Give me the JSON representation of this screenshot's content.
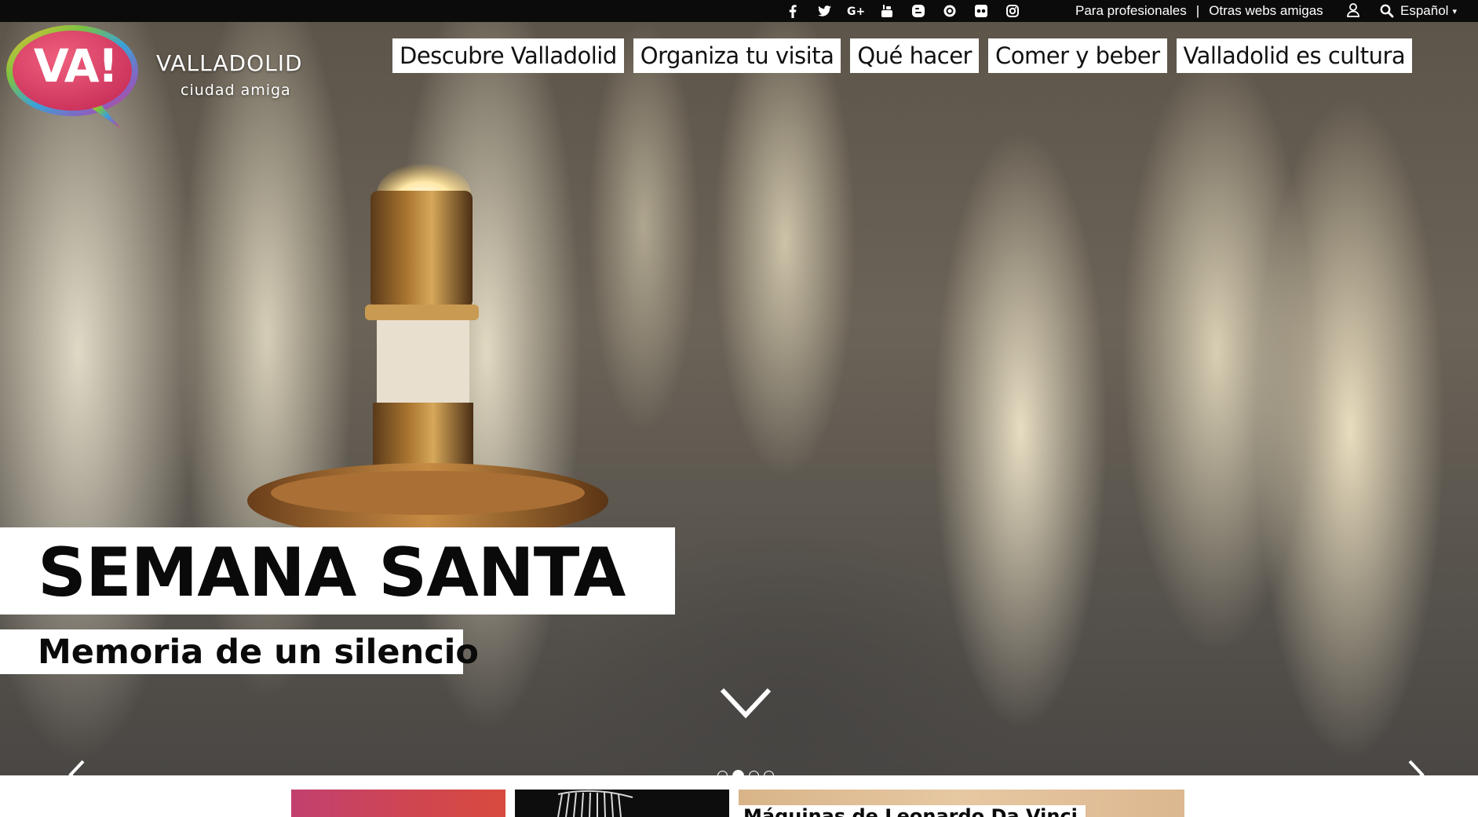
{
  "topbar": {
    "social_icons": [
      "facebook-icon",
      "twitter-icon",
      "google-plus-icon",
      "youtube-icon",
      "blogger-icon",
      "issuu-icon",
      "flickr-icon",
      "instagram-icon"
    ],
    "links": [
      {
        "label": "Para profesionales"
      },
      {
        "label": "Otras webs amigas"
      }
    ],
    "separator": "|",
    "language": "Español",
    "background": "#0b0b0b"
  },
  "logo": {
    "mark": "VA!",
    "title": "VALLADOLID",
    "subtitle": "ciudad amiga"
  },
  "nav": {
    "items": [
      {
        "label": "Descubre Valladolid"
      },
      {
        "label": "Organiza tu visita"
      },
      {
        "label": "Qué hacer"
      },
      {
        "label": "Comer y beber"
      },
      {
        "label": "Valladolid es cultura"
      }
    ]
  },
  "hero": {
    "title": "SEMANA SANTA",
    "subtitle": "Memoria de un silencio",
    "slides_total": 4,
    "active_slide": 2
  },
  "cards": [
    {
      "label": "",
      "color": "#c94560"
    },
    {
      "label": "",
      "color": "#0d0d0d"
    },
    {
      "label": "Máquinas de Leonardo Da Vinci",
      "color": "#e0bf98"
    }
  ]
}
